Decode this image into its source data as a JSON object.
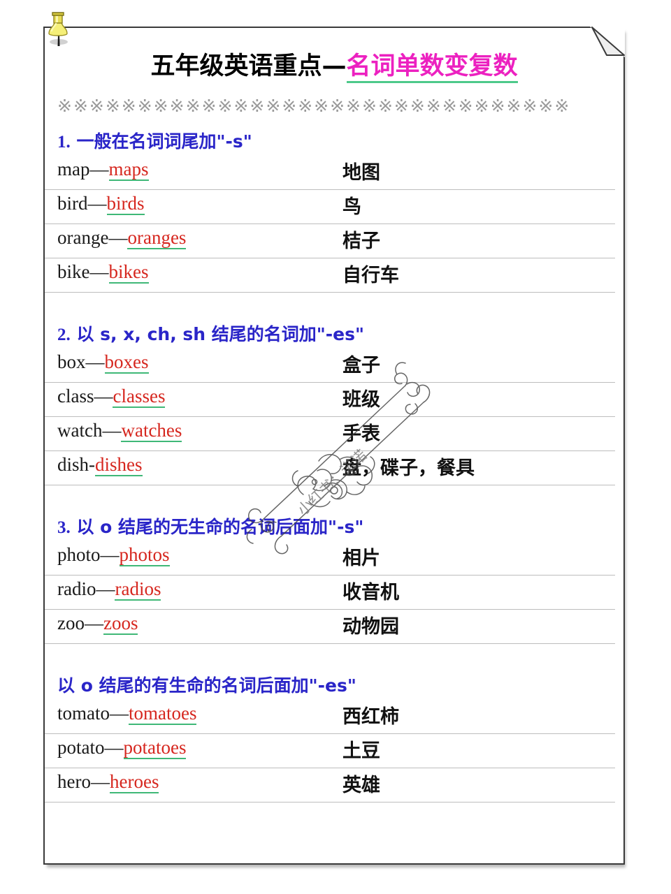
{
  "document": {
    "title_black": "五年级英语重点—",
    "title_pink": "名词单数变复数",
    "separator": "※※※※※※※※※※※※※※※※※※※※※※※※※※※※※※※※",
    "pin_icon": "pushpin-icon",
    "corner_icon": "page-fold-icon"
  },
  "watermark": {
    "text": "小红书：诺诺",
    "icon": "ribbon-banner-icon"
  },
  "sections": [
    {
      "heading_number": "1.",
      "heading_text": "一般在名词词尾加\"-s\"",
      "rows": [
        {
          "singular": "map—",
          "plural": "maps",
          "zh": "地图"
        },
        {
          "singular": "bird—",
          "plural": "birds ",
          "zh": "鸟"
        },
        {
          "singular": "orange—",
          "plural": "oranges",
          "zh": "桔子"
        },
        {
          "singular": "bike—",
          "plural": "bikes",
          "zh": "自行车"
        }
      ]
    },
    {
      "heading_number": "2.",
      "heading_text": "以 s, x, ch, sh 结尾的名词加\"-es\"",
      "rows": [
        {
          "singular": "box—",
          "plural": "boxes",
          "zh": "盒子"
        },
        {
          "singular": "class—",
          "plural": "classes",
          "zh": "班级"
        },
        {
          "singular": "watch—",
          "plural": "watches",
          "zh": "手表"
        },
        {
          "singular": "dish-",
          "plural": "dishes",
          "zh": "盘，碟子，餐具"
        }
      ]
    },
    {
      "heading_number": "3.",
      "heading_text": "以 o 结尾的无生命的名词后面加\"-s\"",
      "rows": [
        {
          "singular": "photo—",
          "plural": "photos",
          "zh": "相片"
        },
        {
          "singular": "radio—",
          "plural": "radios",
          "zh": "收音机"
        },
        {
          "singular": "zoo—",
          "plural": "zoos",
          "zh": "动物园"
        }
      ]
    },
    {
      "heading_number": "",
      "heading_text": "以 o 结尾的有生命的名词后面加\"-es\"",
      "rows": [
        {
          "singular": "tomato—",
          "plural": "tomatoes",
          "zh": "西红柿"
        },
        {
          "singular": "potato—",
          "plural": "potatoes",
          "zh": "土豆"
        },
        {
          "singular": "hero—",
          "plural": "heroes",
          "zh": "英雄"
        }
      ]
    }
  ],
  "colors": {
    "title_accent": "#ec21c0",
    "title_underline": "#4ec98a",
    "heading": "#2a25c8",
    "plural": "#d6271f",
    "plural_underline": "#3fb877",
    "separator": "#9a9a9a",
    "pin": "#f2e85c"
  }
}
